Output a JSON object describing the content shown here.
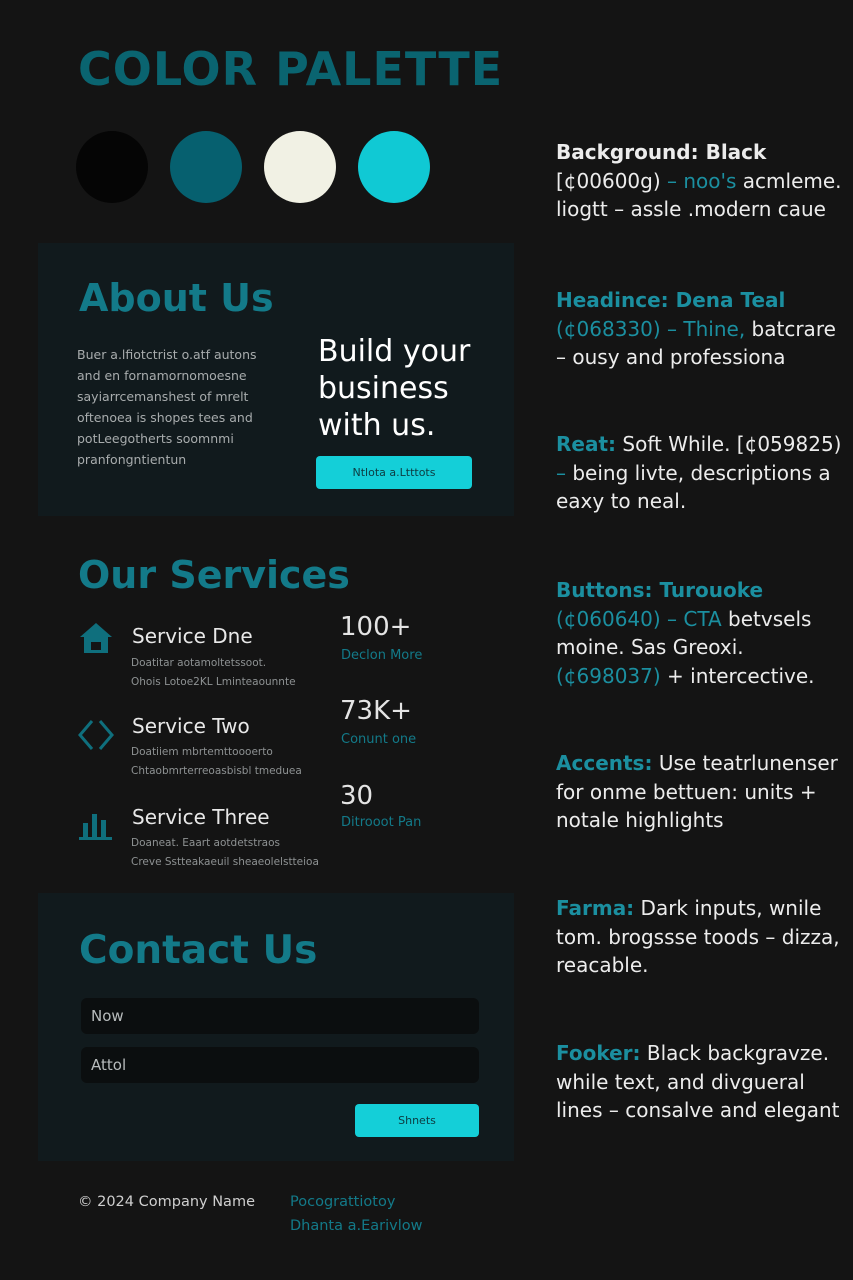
{
  "title": "COLOR PALETTE",
  "colors": {
    "swatch_black": "#050505",
    "swatch_teal": "#06606f",
    "swatch_white": "#f1f1e4",
    "swatch_cyan": "#10c9d4",
    "accent": "#137a89",
    "button": "#14cfd8"
  },
  "about": {
    "heading": "About Us",
    "body": "Buer a.lfiotctrist o.atf autons and en fornamornomoesne sayiarrcemanshest of mrelt oftenoea is shopes tees and potLeegotherts soomnmi pranfongntientun",
    "tagline": "Build your business with us.",
    "button_label": "Ntlota a.Ltttots"
  },
  "services": {
    "heading": "Our Services",
    "items": [
      {
        "icon": "house-icon",
        "title": "Service Dne",
        "desc1": "Doatitar aotamoltetssoot.",
        "desc2": "Ohois Lotoe2KL Lminteaounnte"
      },
      {
        "icon": "diamond-icon",
        "title": "Service Two",
        "desc1": "Doatiiem mbrtemttoooerto",
        "desc2": "Chtaobmrterreoasbisbl tmeduea"
      },
      {
        "icon": "bar-chart-icon",
        "title": "Service Three",
        "desc1": "Doaneat. Eaart aotdetstraos",
        "desc2": "Creve Sstteakaeuil sheaeolelstteioa"
      }
    ],
    "stats": [
      {
        "value": "100+",
        "label": "Declon More"
      },
      {
        "value": "73K+",
        "label": "Conunt one"
      },
      {
        "value": "30",
        "label": "Ditrooot Pan"
      }
    ]
  },
  "contact": {
    "heading": "Contact Us",
    "field1": "Now",
    "field2": "Attol",
    "submit_label": "Shnets"
  },
  "footer": {
    "copyright": "© 2024 Company Name",
    "link1": "Pocograttiotoy",
    "link2": "Dhanta a.Earivlow"
  },
  "notes": [
    {
      "parts": [
        {
          "t": "Background:",
          "c": "strong"
        },
        {
          "t": "  Black",
          "c": "strong"
        },
        {
          "t": " [¢00600g)",
          "c": ""
        },
        {
          "t": " – noo's",
          "c": "hl"
        },
        {
          "t": " acmleme. liogtt  – assle .modern caue",
          "c": ""
        }
      ]
    },
    {
      "parts": [
        {
          "t": "Headince: Dena Teal",
          "c": "hl strong"
        },
        {
          "t": " (¢068330) – Thine,",
          "c": "hl"
        },
        {
          "t": " batcrare – ousy and professiona",
          "c": ""
        }
      ]
    },
    {
      "parts": [
        {
          "t": "Reat:",
          "c": "hl strong"
        },
        {
          "t": " Soft While.",
          "c": ""
        },
        {
          "t": " [¢059825)",
          "c": ""
        },
        {
          "t": " –",
          "c": "hl"
        },
        {
          "t": " being livte, descriptions a eaxy to neal.",
          "c": ""
        }
      ]
    },
    {
      "parts": [
        {
          "t": "Buttons: Turouoke",
          "c": "hl strong"
        },
        {
          "t": " (¢060640) – CTA",
          "c": "hl"
        },
        {
          "t": " betvsels moine. Sas Greoxi.",
          "c": ""
        },
        {
          "t": " (¢698037)",
          "c": "hl"
        },
        {
          "t": " + intercective.",
          "c": ""
        }
      ]
    },
    {
      "parts": [
        {
          "t": "Accents:",
          "c": "hl strong"
        },
        {
          "t": " Use teatrlunenser for onme bettuen: units + notale highlights",
          "c": ""
        }
      ]
    },
    {
      "parts": [
        {
          "t": "Farma:",
          "c": "hl strong"
        },
        {
          "t": " Dark inputs, wnile tom. brogssse toods – dizza, reacable.",
          "c": ""
        }
      ]
    },
    {
      "parts": [
        {
          "t": "Fooker:",
          "c": "hl strong"
        },
        {
          "t": " Black backgravze. while text, and divgueral lines – consalve and elegant",
          "c": ""
        }
      ]
    }
  ]
}
